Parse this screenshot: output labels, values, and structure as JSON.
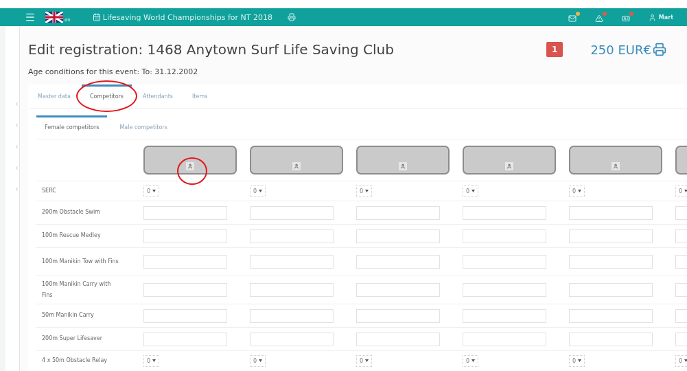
{
  "navbar": {
    "language": "en",
    "event_title": "Lifesaving World Championships for NT 2018",
    "notifications": [
      {
        "kind": "mail",
        "color": "#e8b64a"
      },
      {
        "kind": "warning",
        "color": "#e05a4a"
      },
      {
        "kind": "card",
        "color": "#e05a4a"
      }
    ],
    "user": "Mart"
  },
  "title": "Edit registration: 1468 Anytown Surf Life Saving Club",
  "age_conditions": "Age conditions for this event: To: 31.12.2002",
  "badge": "1",
  "total": "250 EUR€",
  "tabs": [
    {
      "label": "Master data",
      "selected": false,
      "highlighted": false
    },
    {
      "label": "Competitors",
      "selected": true,
      "highlighted": true
    },
    {
      "label": "Attendants",
      "selected": false,
      "highlighted": false
    },
    {
      "label": "Items",
      "selected": false,
      "highlighted": false
    }
  ],
  "subtabs": [
    {
      "label": "Female competitors",
      "selected": true
    },
    {
      "label": "Male competitors",
      "selected": false
    }
  ],
  "competitor_slots": [
    {
      "kind": "empty",
      "highlighted": true
    },
    {
      "kind": "empty",
      "highlighted": false
    },
    {
      "kind": "empty",
      "highlighted": false
    },
    {
      "kind": "empty",
      "highlighted": false
    },
    {
      "kind": "empty",
      "highlighted": false
    },
    {
      "kind": "empty",
      "highlighted": false
    }
  ],
  "events": [
    {
      "label": "SERC",
      "kind": "select",
      "values": [
        "0",
        "0",
        "0",
        "0",
        "0",
        "0"
      ]
    },
    {
      "label": "200m Obstacle Swim",
      "kind": "input"
    },
    {
      "label": "100m Rescue Medley",
      "kind": "input"
    },
    {
      "label": "100m Manikin Tow with Fins",
      "kind": "input"
    },
    {
      "label": "100m Manikin Carry with Fins",
      "kind": "input"
    },
    {
      "label": "50m Manikin Carry",
      "kind": "input"
    },
    {
      "label": "200m Super Lifesaver",
      "kind": "input"
    },
    {
      "label": "4 x 50m Obstacle Relay",
      "kind": "select",
      "values": [
        "0",
        "0",
        "0",
        "0",
        "0",
        "0"
      ]
    }
  ]
}
